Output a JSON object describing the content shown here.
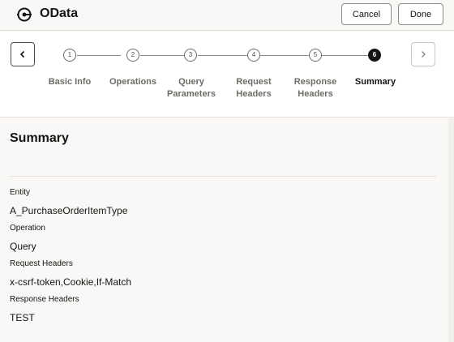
{
  "header": {
    "title": "OData",
    "icon": "odata-connection-icon",
    "cancel_label": "Cancel",
    "done_label": "Done"
  },
  "train": {
    "prev_icon": "chevron-left-icon",
    "next_icon": "chevron-right-icon",
    "steps": [
      {
        "number": "1",
        "label_line1": "Basic Info",
        "label_line2": ""
      },
      {
        "number": "2",
        "label_line1": "Operations",
        "label_line2": ""
      },
      {
        "number": "3",
        "label_line1": "Query",
        "label_line2": "Parameters"
      },
      {
        "number": "4",
        "label_line1": "Request",
        "label_line2": "Headers"
      },
      {
        "number": "5",
        "label_line1": "Response",
        "label_line2": "Headers"
      },
      {
        "number": "6",
        "label_line1": "Summary",
        "label_line2": ""
      }
    ],
    "active_step": "6"
  },
  "summary": {
    "title": "Summary",
    "fields": [
      {
        "label": "Entity",
        "value": "A_PurchaseOrderItemType"
      },
      {
        "label": "Operation",
        "value": "Query"
      },
      {
        "label": "Request Headers",
        "value": "x-csrf-token,Cookie,If-Match"
      },
      {
        "label": "Response Headers",
        "value": "TEST"
      }
    ]
  },
  "colors": {
    "accent": "#161513",
    "background": "#f9f8f6",
    "border": "#8e8a85"
  }
}
